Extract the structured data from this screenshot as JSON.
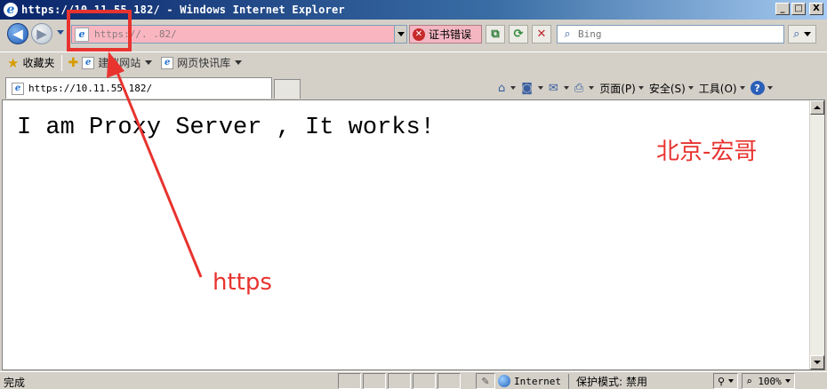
{
  "window": {
    "title": "https://10.11.55.182/ - Windows Internet Explorer",
    "btn_min": "_",
    "btn_max": "□",
    "btn_close": "X"
  },
  "address": {
    "url": "https://.             .82/",
    "cert_error": "证书错误"
  },
  "search": {
    "placeholder": "Bing"
  },
  "favorites": {
    "label": "收藏夹",
    "items": [
      {
        "label": "建议网站"
      },
      {
        "label": "网页快讯库"
      }
    ]
  },
  "tab": {
    "label": "https://10.11.55.182/"
  },
  "command_bar": {
    "page": "页面(P)",
    "safety": "安全(S)",
    "tools": "工具(O)"
  },
  "page": {
    "body_text": "I am Proxy Server , It works!",
    "watermark": "北京-宏哥",
    "annotation": "https"
  },
  "status": {
    "left": "完成",
    "zone": "Internet",
    "protected_label": "保护模式:",
    "protected_value": "禁用",
    "zoom": "100%"
  },
  "colors": {
    "annotation_red": "#e8332f",
    "cert_error_bg": "#f4b7c2",
    "address_bg": "#f9b6c0"
  }
}
